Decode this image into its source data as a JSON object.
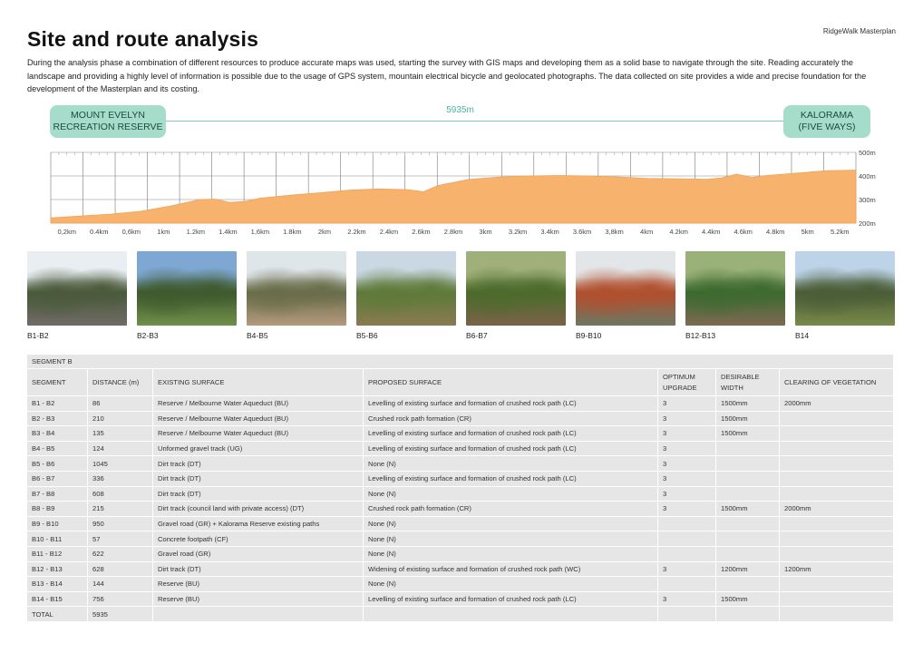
{
  "brand": "RidgeWalk Masterplan",
  "title": "Site and route analysis",
  "intro": "During the analysis phase a combination of different resources to produce accurate maps was used, starting the survey with GIS maps and developing them as a solid base to navigate through the site. Reading accurately the landscape and providing a highly level of information is possible due to the usage of GPS system, mountain electrical bicycle and geolocated photographs. The data collected on site provides a wide and precise foundation for the development of the Masterplan and its costing.",
  "route": {
    "start": "MOUNT EVELYN\nRECREATION RESERVE",
    "end": "KALORAMA\n(FIVE WAYS)",
    "distance": "5935m",
    "line_color": "#7fcdb8",
    "pill_color": "#a5dcca"
  },
  "chart_data": {
    "type": "area",
    "title": "",
    "fill_color": "#f7b26e",
    "xlabel": "",
    "ylabel": "",
    "x_ticks": [
      "0,2km",
      "0.4km",
      "0,6km",
      "1km",
      "1.2km",
      "1.4km",
      "1,6km",
      "1.8km",
      "2km",
      "2.2km",
      "2.4km",
      "2.6km",
      "2.8km",
      "3km",
      "3.2km",
      "3.4km",
      "3.6km",
      "3,8km",
      "4km",
      "4.2km",
      "4.4km",
      "4.6km",
      "4.8km",
      "5km",
      "5.2km"
    ],
    "y_ticks": [
      "500m",
      "400m",
      "300m",
      "200m"
    ],
    "ylim": [
      200,
      500
    ],
    "x_km": [
      0,
      0.2,
      0.4,
      0.6,
      0.8,
      1.0,
      1.1,
      1.2,
      1.3,
      1.4,
      1.6,
      1.8,
      2.0,
      2.2,
      2.4,
      2.5,
      2.6,
      2.8,
      3.0,
      3.2,
      3.4,
      3.6,
      3.8,
      4.0,
      4.2,
      4.4,
      4.5,
      4.6,
      4.7,
      4.8,
      5.0,
      5.2,
      5.4
    ],
    "elevation_m": [
      222,
      230,
      238,
      250,
      272,
      300,
      302,
      288,
      292,
      305,
      318,
      328,
      340,
      345,
      342,
      333,
      360,
      385,
      395,
      400,
      402,
      400,
      396,
      390,
      388,
      386,
      392,
      408,
      394,
      402,
      412,
      422,
      425
    ]
  },
  "photos": [
    {
      "label": "B1-B2",
      "sky": "#e9eef2",
      "ground": "#6f6b66",
      "veg": "#4a5a3a"
    },
    {
      "label": "B2-B3",
      "sky": "#7ea7d3",
      "ground": "#6f8f4a",
      "veg": "#3f5a2e"
    },
    {
      "label": "B4-B5",
      "sky": "#dfe6ea",
      "ground": "#b49a7c",
      "veg": "#6a6d4a"
    },
    {
      "label": "B5-B6",
      "sky": "#c9d8e2",
      "ground": "#8a7a52",
      "veg": "#5f7a3a"
    },
    {
      "label": "B6-B7",
      "sky": "#9fb07a",
      "ground": "#7a6248",
      "veg": "#4d6b2c"
    },
    {
      "label": "B9-B10",
      "sky": "#e3e6e8",
      "ground": "#6d7762",
      "veg": "#b0502e"
    },
    {
      "label": "B12-B13",
      "sky": "#9ab27a",
      "ground": "#7c6a52",
      "veg": "#3d6a30"
    },
    {
      "label": "B14",
      "sky": "#bcd3e8",
      "ground": "#7a8a4a",
      "veg": "#4b5d37"
    }
  ],
  "table": {
    "segment_title": "SEGMENT B",
    "headers": [
      "SEGMENT",
      "DISTANCE (m)",
      "EXISTING SURFACE",
      "PROPOSED SURFACE",
      "OPTIMUM UPGRADE",
      "DESIRABLE WIDTH",
      "CLEARING OF VEGETATION"
    ],
    "rows": [
      [
        "B1 - B2",
        "86",
        "Reserve / Melbourne Water Aqueduct (BU)",
        "Levelling of existing surface and formation of crushed rock path (LC)",
        "3",
        "1500mm",
        "2000mm"
      ],
      [
        "B2 - B3",
        "210",
        "Reserve / Melbourne Water Aqueduct (BU)",
        "Crushed rock path formation (CR)",
        "3",
        "1500mm",
        ""
      ],
      [
        "B3 - B4",
        "135",
        "Reserve / Melbourne Water Aqueduct (BU)",
        "Levelling of existing surface and formation of crushed rock path (LC)",
        "3",
        "1500mm",
        ""
      ],
      [
        "B4 - B5",
        "124",
        "Unformed gravel track (UG)",
        "Levelling of existing surface and formation of crushed rock path (LC)",
        "3",
        "",
        ""
      ],
      [
        "B5 - B6",
        "1045",
        "Dirt track (DT)",
        "None (N)",
        "3",
        "",
        ""
      ],
      [
        "B6 - B7",
        "336",
        "Dirt track (DT)",
        "Levelling of existing surface and formation of crushed rock path (LC)",
        "3",
        "",
        ""
      ],
      [
        "B7 - B8",
        "608",
        "Dirt track (DT)",
        "None (N)",
        "3",
        "",
        ""
      ],
      [
        "B8 - B9",
        "215",
        "Dirt track (council land with private access) (DT)",
        "Crushed rock path formation (CR)",
        "3",
        "1500mm",
        "2000mm"
      ],
      [
        "B9 - B10",
        "950",
        "Gravel road (GR) + Kalorama Reserve existing paths",
        "None (N)",
        "",
        "",
        ""
      ],
      [
        "B10 - B11",
        "57",
        "Concrete footpath (CF)",
        "None (N)",
        "",
        "",
        ""
      ],
      [
        "B11 - B12",
        "622",
        "Gravel road (GR)",
        "None (N)",
        "",
        "",
        ""
      ],
      [
        "B12 - B13",
        "628",
        "Dirt track (DT)",
        "Widening of existing surface and formation of crushed rock path (WC)",
        "3",
        "1200mm",
        "1200mm"
      ],
      [
        "B13 - B14",
        "144",
        "Reserve (BU)",
        "None (N)",
        "",
        "",
        ""
      ],
      [
        "B14 - B15",
        "756",
        "Reserve (BU)",
        "Levelling of existing surface and formation of crushed rock path (LC)",
        "3",
        "1500mm",
        ""
      ],
      [
        "TOTAL",
        "5935",
        "",
        "",
        "",
        "",
        ""
      ]
    ]
  }
}
